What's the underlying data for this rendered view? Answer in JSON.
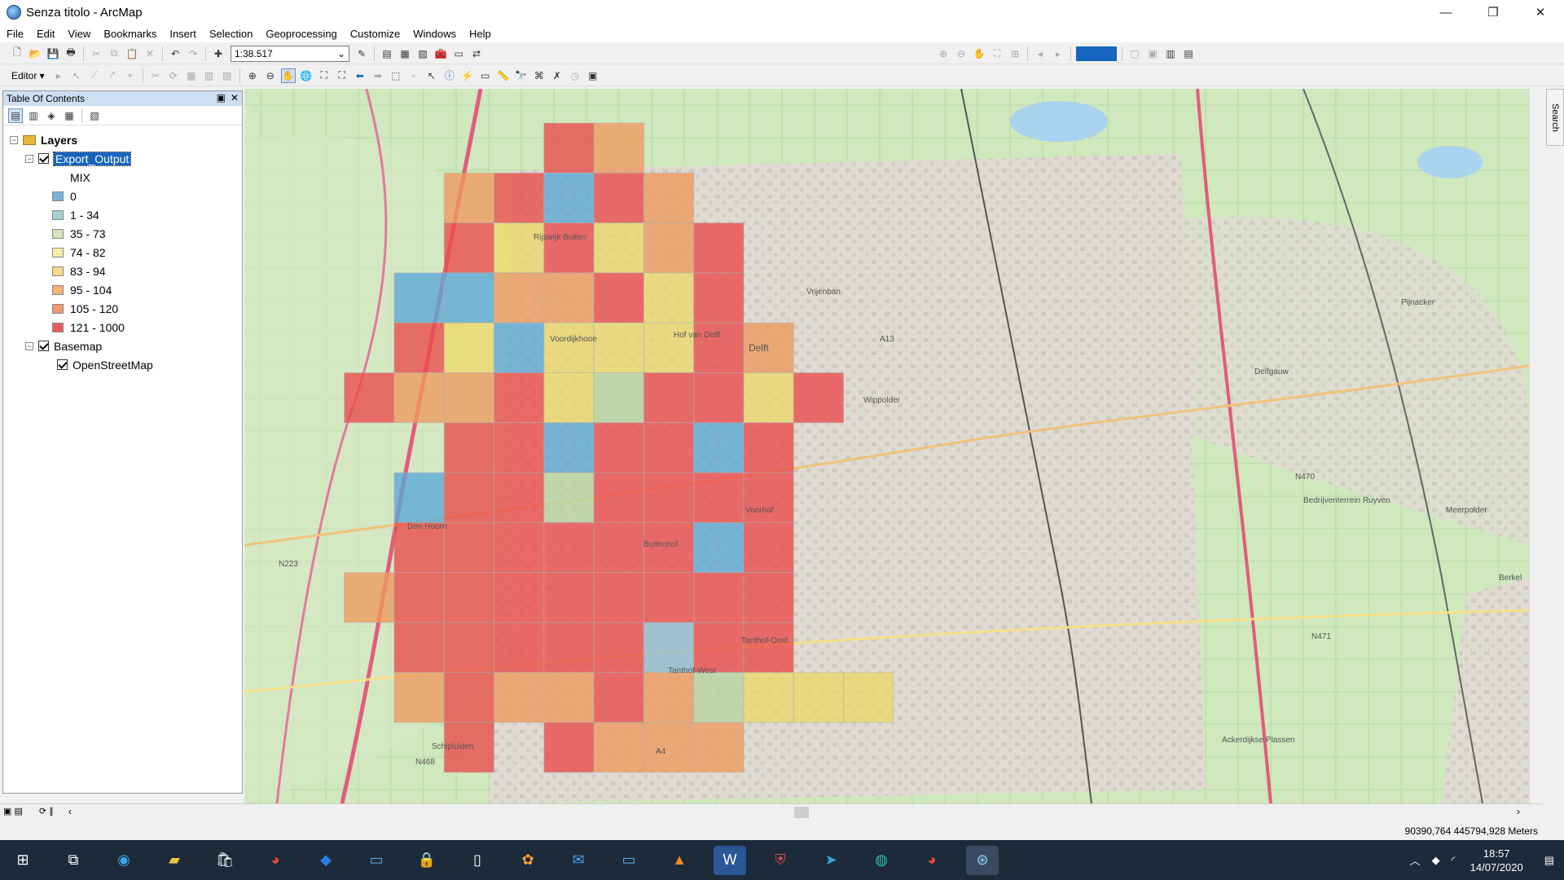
{
  "window": {
    "title": "Senza titolo - ArcMap",
    "minimize": "—",
    "restore": "❐",
    "close": "✕"
  },
  "menu": [
    "File",
    "Edit",
    "View",
    "Bookmarks",
    "Insert",
    "Selection",
    "Geoprocessing",
    "Customize",
    "Windows",
    "Help"
  ],
  "toolbar": {
    "scale": "1:38.517",
    "editor": "Editor ▾"
  },
  "toc": {
    "title": "Table Of Contents",
    "root": "Layers",
    "layer1": {
      "name": "Export_Output",
      "field": "MIX"
    },
    "legend": [
      {
        "label": "0",
        "color": "#7fb2d9"
      },
      {
        "label": "1 - 34",
        "color": "#a9cfd6"
      },
      {
        "label": "35 - 73",
        "color": "#d2e4b8"
      },
      {
        "label": "74 - 82",
        "color": "#f5f0a6"
      },
      {
        "label": "83 - 94",
        "color": "#f7d98a"
      },
      {
        "label": "95 - 104",
        "color": "#f5b27a"
      },
      {
        "label": "105 - 120",
        "color": "#ef9a72"
      },
      {
        "label": "121 - 1000",
        "color": "#e85a5a"
      }
    ],
    "layer2": {
      "name": "Basemap",
      "child": "OpenStreetMap"
    }
  },
  "map": {
    "cell_colors": {
      "R": "#ea4a4a",
      "O": "#ee9a5e",
      "Y": "#ecd86a",
      "B": "#5aa8d6",
      "G": "#b8d4a0",
      "S": "#8fbcd0"
    },
    "grid": [
      "......RO..........",
      "....ORBRO.........",
      "....RYRYOR........",
      "...BBOORYR........",
      "...RYBYYYRO.......",
      "..ROORYGRRYR......",
      "....RRBRRBR.......",
      "...BRRGRRRR.......",
      "...RRRRRRBR.......",
      "..ORRRRRRRR.......",
      "...RRRRRSRR.......",
      "...OROOROGYYY.....",
      "....R.ROOO........"
    ],
    "labels": [
      "Delft",
      "Den Hoorn",
      "Rijswijk Buiten",
      "Delfgauw",
      "Pijnacker",
      "Berkel",
      "Schipluiden",
      "Tanthof-West",
      "Tanthof-Oost",
      "Voorhof",
      "Buitenhof",
      "Wippolder",
      "Vrijenban",
      "Hof van Delft",
      "Voordijkhooe",
      "Ackerdijkse Plassen",
      "Bedrijventerrein Ruyven",
      "Meerpolder",
      "N470",
      "N223",
      "N468",
      "N471",
      "A13",
      "A4"
    ]
  },
  "statusbar": {
    "coords": "90390,764  445794,928 Meters"
  },
  "clock": {
    "time": "18:57",
    "date": "14/07/2020"
  }
}
